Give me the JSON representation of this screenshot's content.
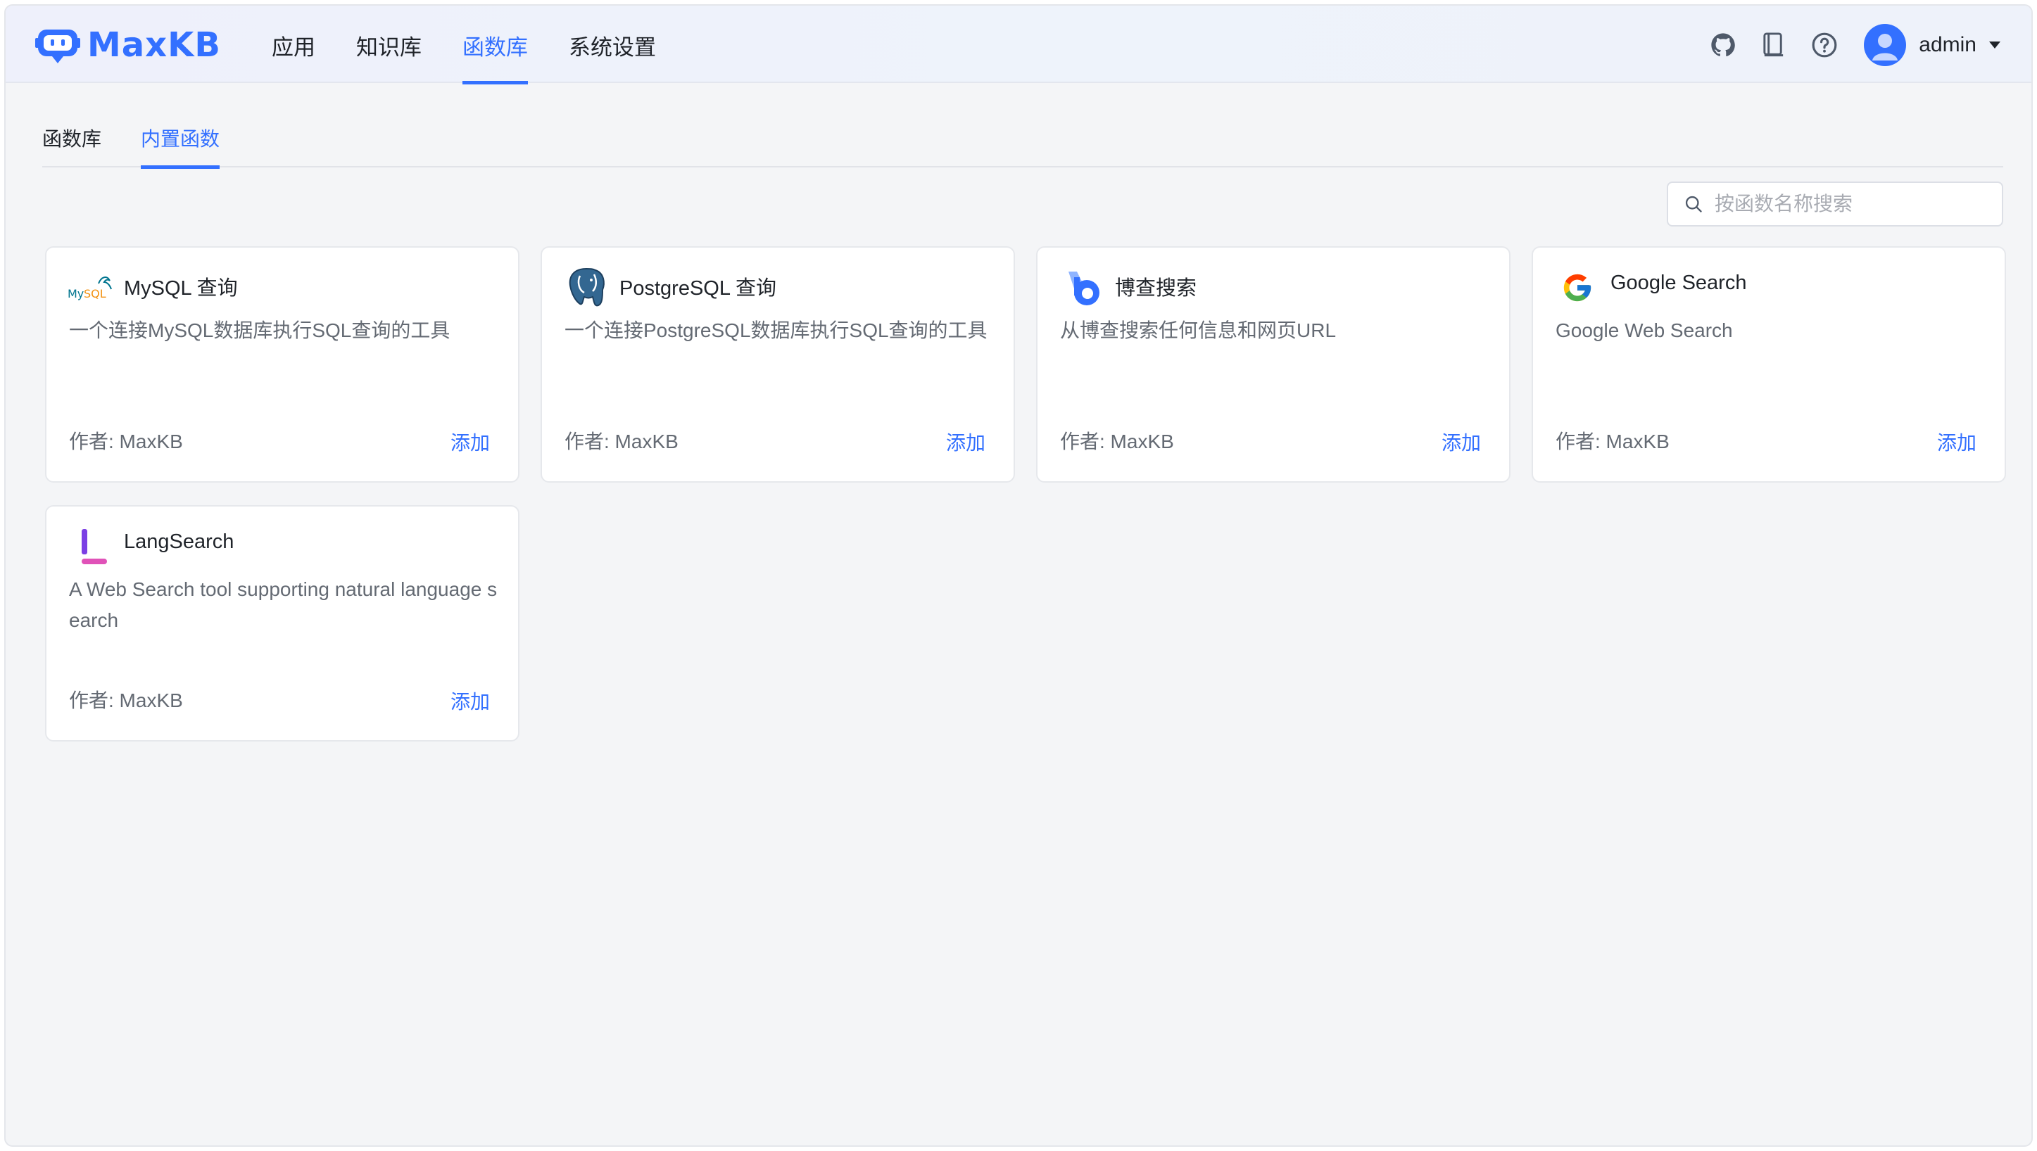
{
  "header": {
    "brand": "MaxKB",
    "nav": [
      {
        "label": "应用"
      },
      {
        "label": "知识库"
      },
      {
        "label": "函数库"
      },
      {
        "label": "系统设置"
      }
    ],
    "user": "admin",
    "icons": [
      "github-icon",
      "docs-book-icon",
      "help-question-icon",
      "user-avatar-icon"
    ]
  },
  "subtabs": [
    {
      "label": "函数库"
    },
    {
      "label": "内置函数"
    }
  ],
  "search": {
    "placeholder": "按函数名称搜索"
  },
  "cards": [
    {
      "title": "MySQL 查询",
      "desc": "一个连接MySQL数据库执行SQL查询的工具",
      "author": "作者: MaxKB",
      "action": "添加",
      "icon": "mysql-logo-icon"
    },
    {
      "title": "PostgreSQL 查询",
      "desc": "一个连接PostgreSQL数据库执行SQL查询的工具",
      "author": "作者: MaxKB",
      "action": "添加",
      "icon": "postgresql-elephant-icon"
    },
    {
      "title": "博查搜索",
      "desc": "从博查搜索任何信息和网页URL",
      "author": "作者: MaxKB",
      "action": "添加",
      "icon": "bocha-logo-icon"
    },
    {
      "title": "Google Search",
      "desc": "Google Web Search",
      "author": "作者: MaxKB",
      "action": "添加",
      "icon": "google-logo-icon"
    },
    {
      "title": "LangSearch",
      "desc": "A Web Search tool supporting natural language search",
      "author": "作者: MaxKB",
      "action": "添加",
      "icon": "langsearch-logo-icon"
    }
  ],
  "colors": {
    "accent": "#3370ff",
    "text": "#1f2329",
    "muted": "#646a73",
    "background": "#f4f5f7"
  }
}
